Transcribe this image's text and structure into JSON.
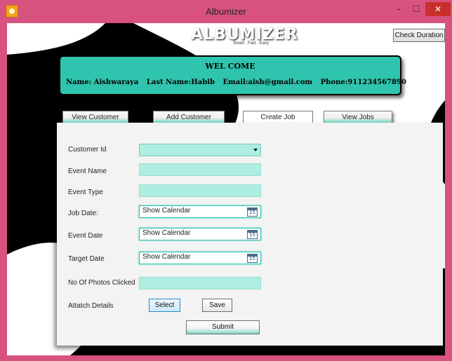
{
  "window": {
    "title": "Albumizer",
    "controls": {
      "minimize": "–",
      "maximize": "☐",
      "close": "✕"
    }
  },
  "header": {
    "logo_text": "ALBUMIZER",
    "logo_tagline": "Smart . Fast . Easy",
    "check_duration_label": "Check Duration"
  },
  "banner": {
    "welcome": "WEL COME",
    "name": "Name: Aishwaraya",
    "last_name": "Last Name:Habib",
    "email": "Email:aish@gmail.com",
    "phone": "Phone:911234567890"
  },
  "tabs": {
    "view_customer": "View Customer",
    "add_customer": "Add Customer",
    "create_job": "Create Job",
    "view_jobs": "View Jobs",
    "active": "Create Job"
  },
  "form": {
    "customer_id_label": "Customer Id",
    "customer_id_value": "",
    "event_name_label": "Event Name",
    "event_name_value": "",
    "event_type_label": "Event Type",
    "event_type_value": "",
    "job_date_label": "Job Date:",
    "job_date_value": "Show Calendar",
    "event_date_label": "Event Date",
    "event_date_value": "Show Calendar",
    "target_date_label": "Target Date",
    "target_date_value": "Show Calendar",
    "calendar_icon_day": "15",
    "photos_label": "No Of Photos Clicked",
    "photos_value": "",
    "attach_label": "Attatch Details",
    "select_label": "Select",
    "save_label": "Save",
    "submit_label": "Submit"
  },
  "colors": {
    "frame": "#d8527f",
    "accent": "#2fc4ad",
    "field": "#aeeee0",
    "close_button": "#c9302c"
  }
}
